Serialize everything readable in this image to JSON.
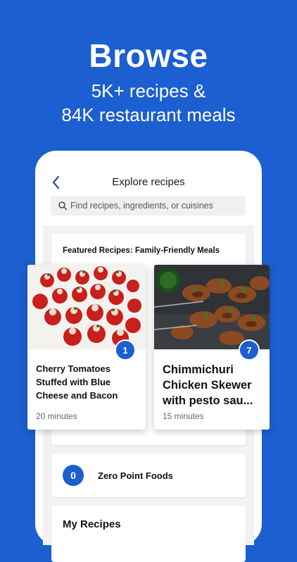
{
  "hero": {
    "title": "Browse",
    "subtitle_line1": "5K+ recipes &",
    "subtitle_line2": "84K restaurant meals"
  },
  "screen": {
    "title": "Explore recipes",
    "search_placeholder": "Find recipes, ingredients, or cuisines"
  },
  "featured": {
    "title": "Featured Recipes: Family-Friendly Meals",
    "cards": [
      {
        "title": "Cherry Tomatoes Stuffed with Blue Cheese and Bacon",
        "points": "1",
        "time": "20 minutes"
      },
      {
        "title": "Chimmichuri Chicken Skewer with pesto sau...",
        "points": "7",
        "time": "15 minutes"
      }
    ]
  },
  "zero_point": {
    "badge": "0",
    "label": "Zero Point Foods"
  },
  "my_recipes": {
    "label": "My Recipes"
  },
  "colors": {
    "brand_blue": "#1b5fd0",
    "feed_bg": "#f2f2f2"
  }
}
